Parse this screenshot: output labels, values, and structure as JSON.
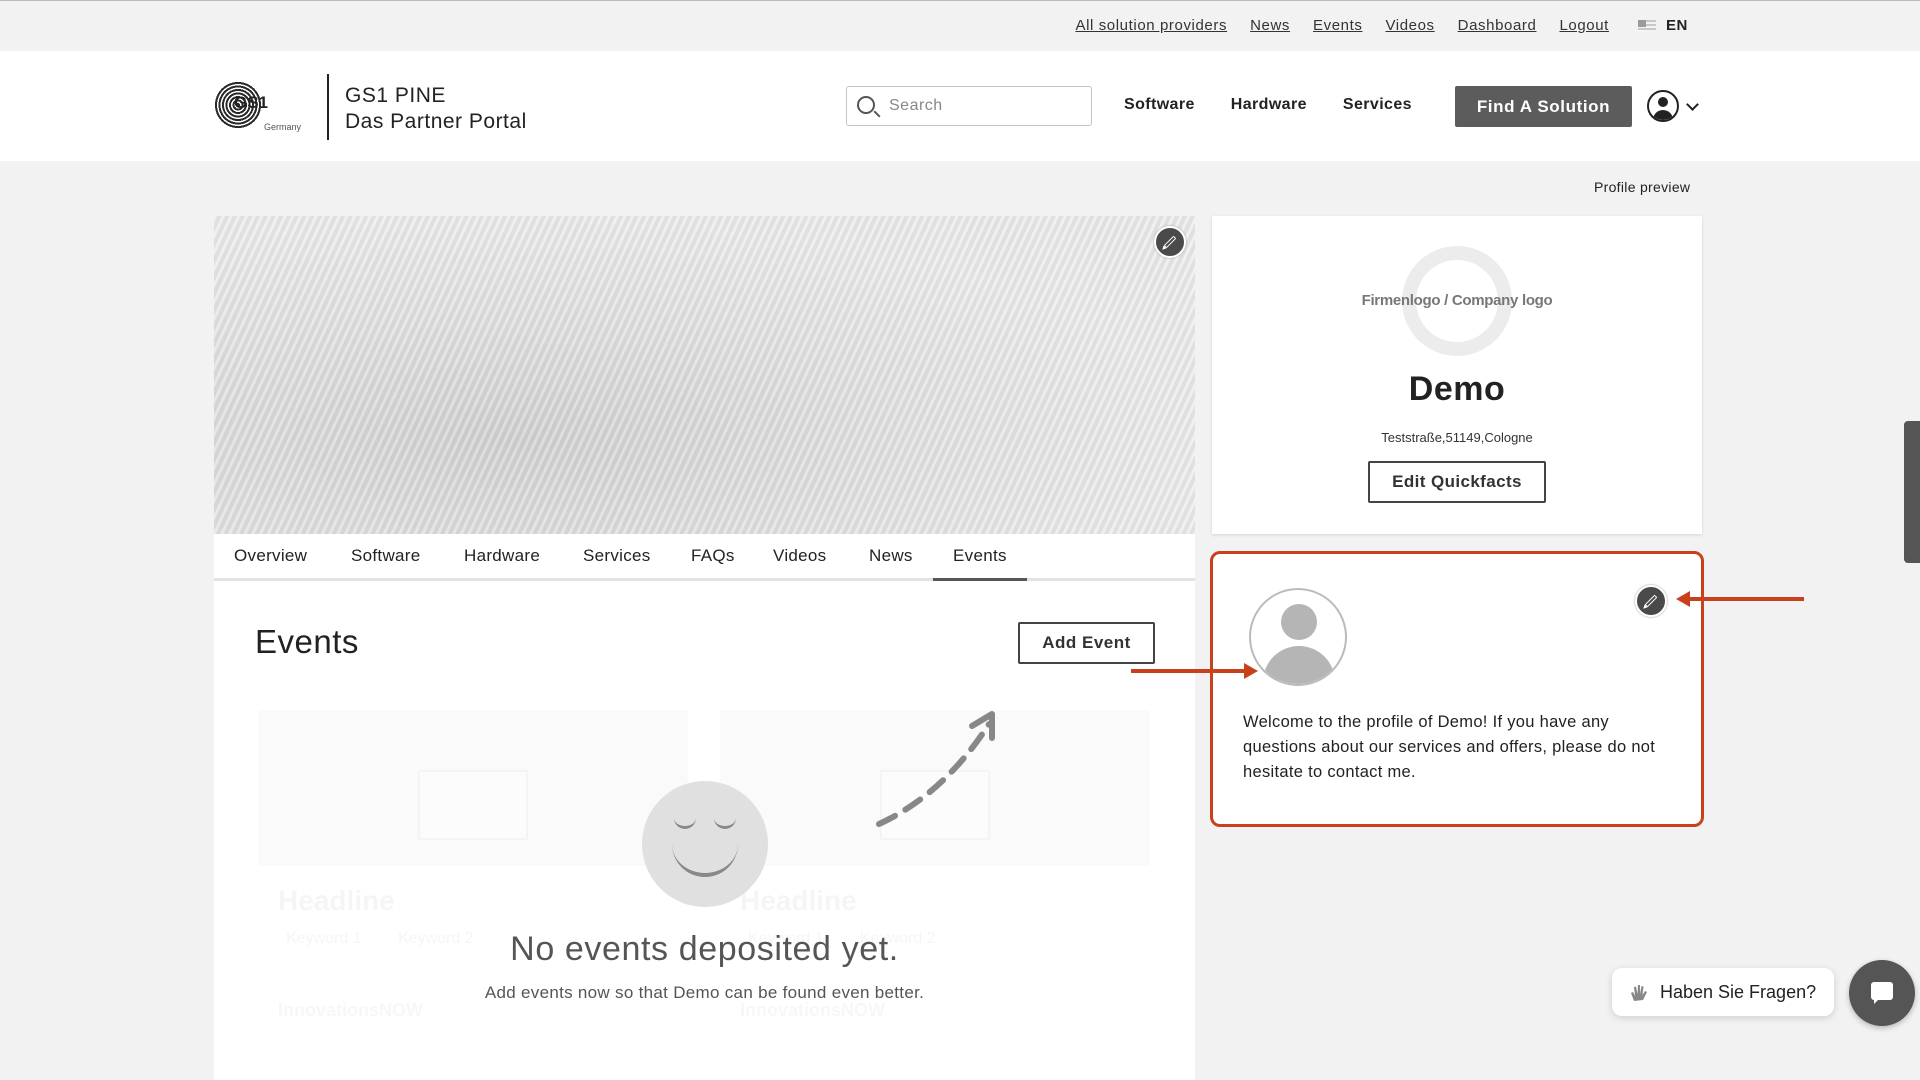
{
  "util_bar": {
    "links": [
      "All solution providers",
      "News",
      "Events",
      "Videos",
      "Dashboard",
      "Logout"
    ],
    "language": "EN"
  },
  "header": {
    "logo_text": "GS1",
    "logo_sub": "Germany",
    "title_line1": "GS1 PINE",
    "title_line2": "Das Partner Portal",
    "search_placeholder": "Search",
    "nav": [
      "Software",
      "Hardware",
      "Services"
    ],
    "cta": "Find A Solution"
  },
  "profile_preview": "Profile preview",
  "tabs": [
    "Overview",
    "Software",
    "Hardware",
    "Services",
    "FAQs",
    "Videos",
    "News",
    "Events"
  ],
  "active_tab": "Events",
  "events": {
    "title": "Events",
    "add_button": "Add Event",
    "ghost_headline": "Headline",
    "ghost_keyword1": "Keyword 1",
    "ghost_keyword2": "Keyword 2",
    "ghost_logo": "InnovationsNOW",
    "empty_title": "No events deposited yet.",
    "empty_sub": "Add events now so that Demo can be found even better."
  },
  "quickfacts": {
    "logo_placeholder": "Firmenlogo / Company logo",
    "company": "Demo",
    "address": "Teststraße,51149,Cologne",
    "edit_button": "Edit Quickfacts"
  },
  "welcome": {
    "text": "Welcome to the profile of Demo! If you have any questions about our services and offers, please do not hesitate to contact me."
  },
  "chat": {
    "bubble": "Haben Sie Fragen?"
  },
  "colors": {
    "highlight": "#c9401c",
    "button_dark": "#5c5c5c"
  }
}
